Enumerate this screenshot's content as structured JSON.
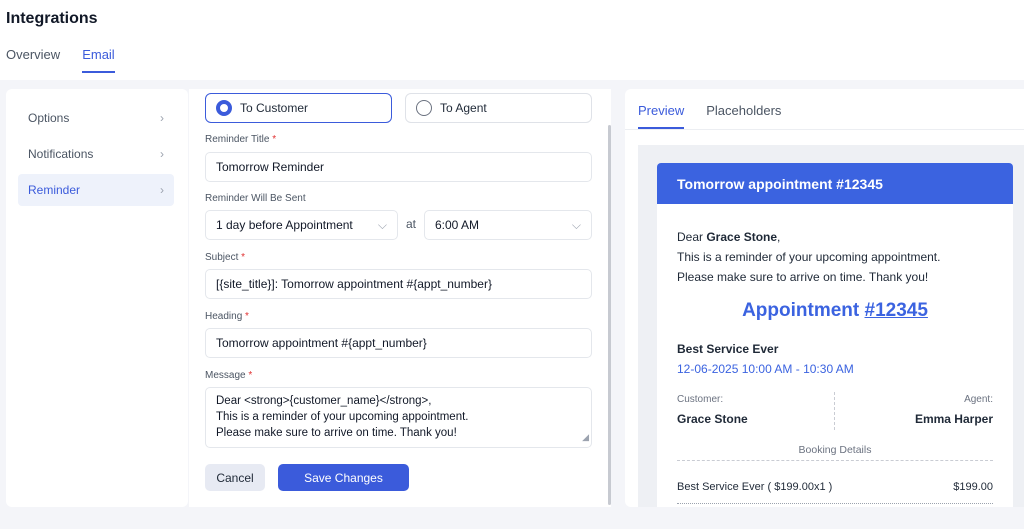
{
  "page": {
    "title": "Integrations"
  },
  "top_tabs": [
    {
      "label": "Overview"
    },
    {
      "label": "Email"
    }
  ],
  "sidebar": {
    "items": [
      {
        "label": "Options"
      },
      {
        "label": "Notifications"
      },
      {
        "label": "Reminder"
      }
    ]
  },
  "form": {
    "recipient": {
      "customer": "To Customer",
      "agent": "To Agent",
      "selected": "To Customer"
    },
    "reminder_title": {
      "label": "Reminder Title",
      "required": "*",
      "value": "Tomorrow Reminder"
    },
    "sent": {
      "label": "Reminder Will Be Sent",
      "when_value": "1 day before Appointment",
      "at_label": "at",
      "time_value": "6:00 AM"
    },
    "subject": {
      "label": "Subject",
      "required": "*",
      "value": "[{site_title}]: Tomorrow appointment #{appt_number}"
    },
    "heading": {
      "label": "Heading",
      "required": "*",
      "value": "Tomorrow appointment #{appt_number}"
    },
    "message": {
      "label": "Message",
      "required": "*",
      "lines": [
        "Dear <strong>{customer_name}</strong>,",
        "This is a reminder of your upcoming appointment.",
        "Please make sure to arrive on time. Thank you!"
      ]
    },
    "cancel_label": "Cancel",
    "save_label": "Save Changes"
  },
  "preview": {
    "tabs": [
      {
        "label": "Preview"
      },
      {
        "label": "Placeholders"
      }
    ],
    "email": {
      "header": "Tomorrow appointment #12345",
      "greeting_prefix": "Dear ",
      "customer_name": "Grace Stone",
      "greeting_suffix": ",",
      "line1": "This is a reminder of your upcoming appointment.",
      "line2": "Please make sure to arrive on time. Thank you!",
      "appointment_label": "Appointment ",
      "appointment_number": "#12345",
      "service": "Best Service Ever",
      "datetime": "12-06-2025 10:00 AM - 10:30 AM",
      "customer_label": "Customer:",
      "customer_value": "Grace Stone",
      "agent_label": "Agent:",
      "agent_value": "Emma Harper",
      "booking_details": "Booking Details",
      "line_item": "Best Service Ever ( $199.00x1 )",
      "line_price": "$199.00"
    }
  },
  "colors": {
    "accent": "#3b5bdb",
    "email_header": "#3b63e0",
    "required": "#e03131"
  }
}
